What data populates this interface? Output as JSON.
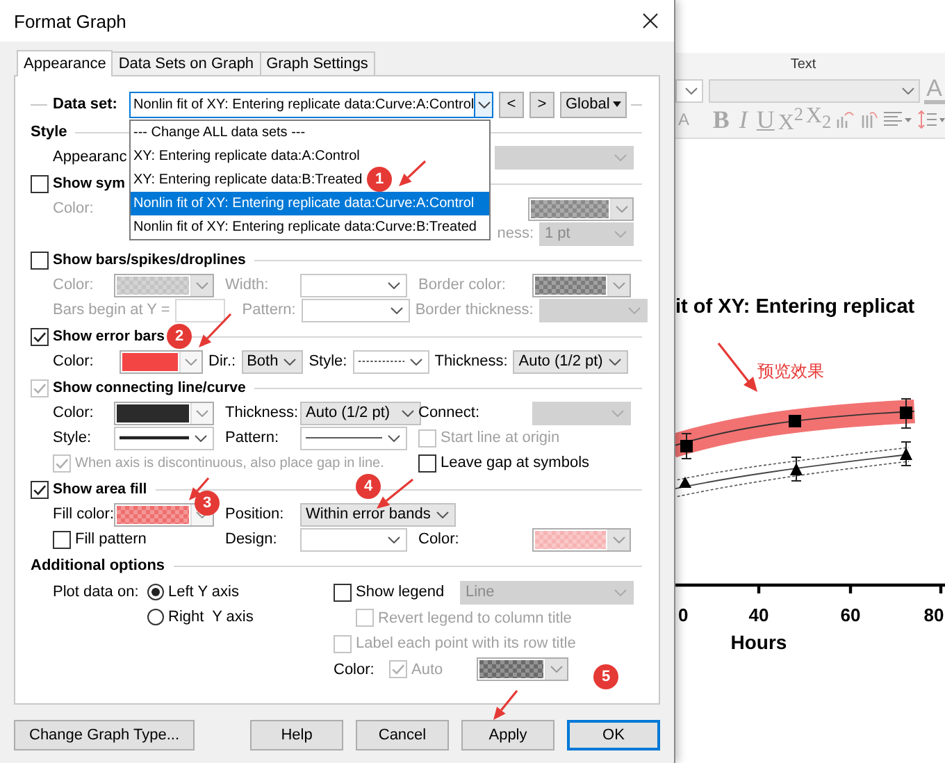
{
  "dialog": {
    "title": "Format Graph",
    "tabs": [
      {
        "label": "Appearance",
        "selected": true
      },
      {
        "label": "Data Sets on Graph",
        "selected": false
      },
      {
        "label": "Graph Settings",
        "selected": false
      }
    ],
    "data_set": {
      "label": "Data set:",
      "value": "Nonlin fit of XY: Entering replicate data:Curve:A:Control",
      "prev": "<",
      "next": ">",
      "scope": "Global",
      "expanded": true,
      "options": [
        {
          "label": "--- Change ALL data sets ---",
          "selected": false
        },
        {
          "label": "XY: Entering replicate data:A:Control",
          "selected": false
        },
        {
          "label": "XY: Entering replicate data:B:Treated",
          "selected": false
        },
        {
          "label": "Nonlin fit of XY: Entering replicate data:Curve:A:Control",
          "selected": true
        },
        {
          "label": "Nonlin fit of XY: Entering replicate data:Curve:B:Treated",
          "selected": false
        }
      ]
    },
    "sections": [
      {
        "header": {
          "kind": "title",
          "label": "Style"
        },
        "rows": [
          {
            "kind": "spread",
            "items": [
              {
                "kind": "label",
                "text": "Appearanc",
                "disabled": false
              },
              {
                "kind": "combo",
                "disabled": true
              }
            ]
          }
        ]
      },
      {
        "header": {
          "kind": "check",
          "label": "Show sym",
          "checked": false,
          "disabled": false
        },
        "rows": [
          {
            "kind": "spread",
            "items": [
              {
                "kind": "label",
                "text": "Color:",
                "disabled": true
              },
              {
                "kind": "swatch",
                "color": "#8a8a8a",
                "checkered": true,
                "disabled": true
              }
            ]
          },
          {
            "kind": "right",
            "items": [
              {
                "kind": "label",
                "text": "ness:",
                "disabled": true
              },
              {
                "kind": "combo",
                "value": "1 pt",
                "disabled": true
              }
            ]
          }
        ]
      },
      {
        "header": {
          "kind": "check",
          "label": "Show bars/spikes/droplines",
          "checked": false,
          "disabled": false
        },
        "rows": [
          {
            "kind": "grid",
            "items": [
              {
                "kind": "label",
                "text": "Color:",
                "disabled": true
              },
              {
                "kind": "swatch",
                "color": "#c4c4c4",
                "checkered": true,
                "disabled": true
              },
              {
                "kind": "label",
                "text": "Width:",
                "disabled": true
              },
              {
                "kind": "combo",
                "disabled": false
              },
              {
                "kind": "label",
                "text": "Border color:",
                "disabled": true
              },
              {
                "kind": "swatch",
                "color": "#7c7c7c",
                "checkered": true,
                "disabled": true
              }
            ]
          },
          {
            "kind": "flow",
            "items": [
              {
                "kind": "label",
                "text": "Bars begin at Y =",
                "disabled": true
              },
              {
                "kind": "input",
                "disabled": true
              },
              {
                "kind": "label",
                "text": "Pattern:",
                "disabled": true
              },
              {
                "kind": "combo",
                "disabled": false
              },
              {
                "kind": "label",
                "text": "Border thickness:",
                "disabled": true
              },
              {
                "kind": "combo",
                "disabled": true
              }
            ]
          }
        ]
      },
      {
        "header": {
          "kind": "check",
          "label": "Show error bars",
          "checked": true,
          "disabled": false
        },
        "rows": [
          {
            "kind": "flow",
            "items": [
              {
                "kind": "label",
                "text": "Color:",
                "disabled": false
              },
              {
                "kind": "swatch",
                "color": "#f44545",
                "checkered": false,
                "disabled": false
              },
              {
                "kind": "label",
                "text": "Dir.:",
                "disabled": false
              },
              {
                "kind": "combo",
                "value": "Both",
                "disabled": false
              },
              {
                "kind": "label",
                "text": "Style:",
                "disabled": false
              },
              {
                "kind": "line",
                "dashed": true,
                "thick": false
              },
              {
                "kind": "label",
                "text": "Thickness:",
                "disabled": false
              },
              {
                "kind": "combo",
                "value": "Auto (1/2 pt)",
                "disabled": false
              }
            ]
          }
        ]
      },
      {
        "header": {
          "kind": "check",
          "label": "Show connecting line/curve",
          "checked": true,
          "disabled": true
        },
        "rows": [
          {
            "kind": "grid",
            "items": [
              {
                "kind": "label",
                "text": "Color:",
                "disabled": false
              },
              {
                "kind": "swatch",
                "color": "#2b2b2b",
                "checkered": false,
                "disabled": false
              },
              {
                "kind": "label",
                "text": "Thickness:",
                "disabled": false
              },
              {
                "kind": "combo",
                "value": "Auto (1/2 pt)",
                "disabled": false
              },
              {
                "kind": "label",
                "text": "Connect:",
                "disabled": false
              },
              {
                "kind": "combo",
                "disabled": true
              }
            ]
          },
          {
            "kind": "grid",
            "items": [
              {
                "kind": "label",
                "text": "Style:",
                "disabled": false
              },
              {
                "kind": "line",
                "dashed": false,
                "thick": true
              },
              {
                "kind": "label",
                "text": "Pattern:",
                "disabled": false
              },
              {
                "kind": "line",
                "dashed": false,
                "thick": false
              },
              {
                "kind": "check",
                "label": "Start line at origin",
                "checked": false,
                "disabled": true
              }
            ]
          },
          {
            "kind": "split",
            "items": [
              {
                "kind": "check",
                "label": "When axis is discontinuous, also place gap in line.",
                "checked": true,
                "disabled": true
              },
              {
                "kind": "check",
                "label": "Leave gap at symbols",
                "checked": false,
                "disabled": false
              }
            ]
          }
        ]
      },
      {
        "header": {
          "kind": "check",
          "label": "Show area fill",
          "checked": true,
          "disabled": false
        },
        "rows": [
          {
            "kind": "grid",
            "items": [
              {
                "kind": "label",
                "text": "Fill color:",
                "disabled": false
              },
              {
                "kind": "swatch",
                "color": "#ef6f6f",
                "checkered": true,
                "disabled": false
              },
              {
                "kind": "label",
                "text": "Position:",
                "disabled": false
              },
              {
                "kind": "combo",
                "value": "Within error bands",
                "disabled": false
              }
            ]
          },
          {
            "kind": "grid",
            "items": [
              {
                "kind": "check",
                "label": "Fill pattern",
                "checked": false,
                "disabled": false
              },
              {
                "kind": "label",
                "text": "Design:",
                "disabled": false
              },
              {
                "kind": "combo",
                "disabled": false
              },
              {
                "kind": "label",
                "text": "Color:",
                "disabled": false
              },
              {
                "kind": "swatch",
                "color": "#f7b3b3",
                "checkered": true,
                "disabled": true
              }
            ]
          }
        ]
      }
    ],
    "additional": {
      "title": "Additional options",
      "plot_label": "Plot data on:",
      "axes": [
        {
          "label": "Left Y axis",
          "selected": true
        },
        {
          "label": "Right  Y axis",
          "selected": false
        }
      ],
      "legend": {
        "label": "Show legend",
        "checked": false,
        "disabled": false,
        "style": {
          "value": "Line",
          "disabled": true
        },
        "revert": {
          "label": "Revert legend to column title",
          "checked": false,
          "disabled": true
        }
      },
      "label_points": {
        "label": "Label each point with its row title",
        "checked": false,
        "disabled": true
      },
      "color": {
        "label": "Color:",
        "auto": {
          "label": "Auto",
          "checked": true,
          "disabled": true
        },
        "swatch": {
          "color": "#6a6a6a",
          "checkered": true,
          "disabled": true
        }
      }
    },
    "buttons": [
      {
        "label": "Change Graph Type...",
        "default": false
      },
      {
        "label": "Help",
        "default": false
      },
      {
        "label": "Cancel",
        "default": false
      },
      {
        "label": "Apply",
        "default": false
      },
      {
        "label": "OK",
        "default": true
      }
    ]
  },
  "app": {
    "ribbon": {
      "group_label": "Text",
      "font_color": "A",
      "highlight": "A",
      "format_buttons": [
        "B",
        "I",
        "U",
        "X$^{2}$",
        "X$_{2}$"
      ]
    },
    "chart": {
      "title": "it of XY: Entering replicat",
      "xticks": [
        "0",
        "40",
        "60",
        "80"
      ],
      "xlabel": "Hours"
    },
    "preview_note": "预览效果"
  },
  "annotations": [
    "1",
    "2",
    "3",
    "4",
    "5"
  ]
}
